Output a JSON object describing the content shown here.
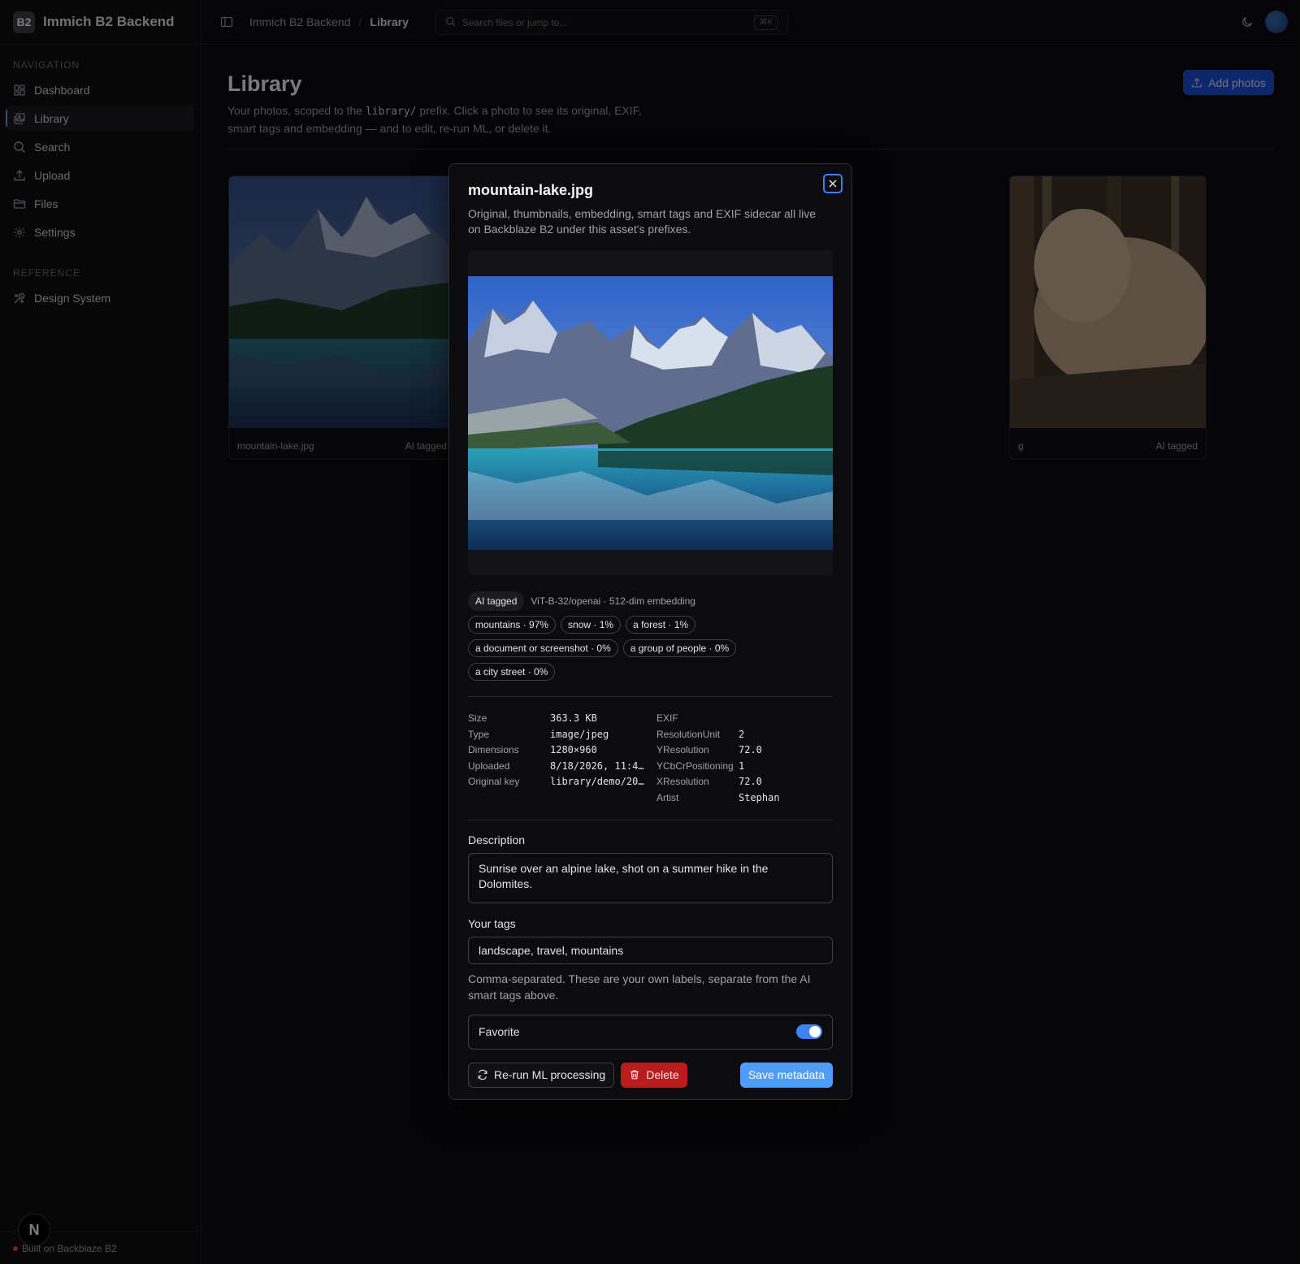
{
  "app": {
    "logo": "B2",
    "title": "Immich B2 Backend"
  },
  "nav": {
    "heading": "NAVIGATION",
    "items": [
      {
        "label": "Dashboard",
        "icon": "dashboard-icon"
      },
      {
        "label": "Library",
        "icon": "library-icon",
        "active": true
      },
      {
        "label": "Search",
        "icon": "search-icon"
      },
      {
        "label": "Upload",
        "icon": "upload-icon"
      },
      {
        "label": "Files",
        "icon": "folder-icon"
      },
      {
        "label": "Settings",
        "icon": "gear-icon"
      }
    ],
    "reference_heading": "REFERENCE",
    "reference_items": [
      {
        "label": "Design System",
        "icon": "palette-icon"
      }
    ]
  },
  "footer": {
    "text": "Built on Backblaze B2",
    "badge": "N"
  },
  "topbar": {
    "breadcrumb": [
      "Immich B2 Backend",
      "Library"
    ],
    "search_placeholder": "Search files or jump to...",
    "shortcut": "⌘K"
  },
  "page": {
    "title": "Library",
    "desc_before": "Your photos, scoped to the ",
    "desc_code": "library/",
    "desc_after": " prefix. Click a photo to see its original, EXIF, smart tags and embedding — and to edit, re-run ML, or delete it.",
    "add_button": "Add photos"
  },
  "cards": [
    {
      "name": "mountain-lake.jpg",
      "status": "AI tagged"
    },
    {
      "name": "g",
      "status": "AI tagged"
    }
  ],
  "modal": {
    "title": "mountain-lake.jpg",
    "description": "Original, thumbnails, embedding, smart tags and EXIF sidecar all live on Backblaze B2 under this asset's prefixes.",
    "ai_badge": "AI tagged",
    "model_info": "ViT-B-32/openai · 512-dim embedding",
    "smart_tags": [
      "mountains · 97%",
      "snow · 1%",
      "a forest · 1%",
      "a document or screenshot · 0%",
      "a group of people · 0%",
      "a city street · 0%"
    ],
    "meta": {
      "keys": [
        "Size",
        "Type",
        "Dimensions",
        "Uploaded",
        "Original key"
      ],
      "values": [
        "363.3 KB",
        "image/jpeg",
        "1280×960",
        "8/18/2026, 11:4…",
        "library/demo/20…"
      ]
    },
    "exif": {
      "heading": "EXIF",
      "keys": [
        "ResolutionUnit",
        "YResolution",
        "YCbCrPositioning",
        "XResolution",
        "Artist"
      ],
      "values": [
        "2",
        "72.0",
        "1",
        "72.0",
        "Stephan"
      ]
    },
    "description_label": "Description",
    "description_value": "Sunrise over an alpine lake, shot on a summer hike in the Dolomites.",
    "tags_label": "Your tags",
    "tags_value": "landscape, travel, mountains",
    "tags_hint": "Comma-separated. These are your own labels, separate from the AI smart tags above.",
    "favorite_label": "Favorite",
    "favorite_on": true,
    "rerun_button": "Re-run ML processing",
    "delete_button": "Delete",
    "save_button": "Save metadata"
  }
}
